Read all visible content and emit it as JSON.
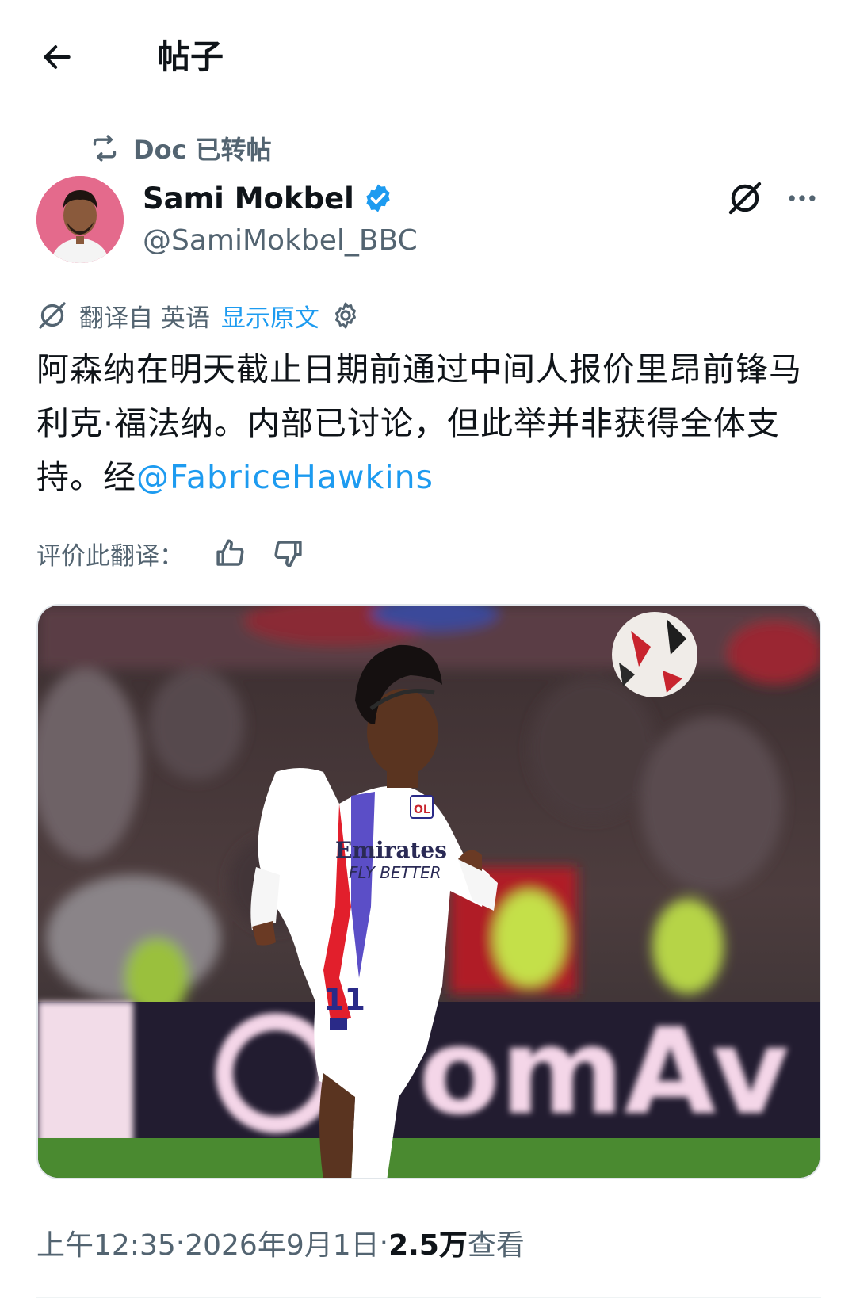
{
  "header": {
    "title": "帖子",
    "back_icon": "arrow-left-icon"
  },
  "retweet": {
    "text": "Doc 已转帖",
    "icon": "retweet-icon"
  },
  "author": {
    "name": "Sami Mokbel",
    "handle": "@SamiMokbel_BBC",
    "verified_color": "#1d9bf0",
    "avatar_bg": "#e46a8c"
  },
  "translation": {
    "label": "翻译自 英语",
    "show_original": "显示原文",
    "settings_icon": "gear-icon"
  },
  "tweet": {
    "text_main": "阿森纳在明天截止日期前通过中间人报价里昂前锋马利克·福法纳。内部已讨论，但此举并非获得全体支持。经",
    "mention": "@FabriceHawkins"
  },
  "rate": {
    "label": "评价此翻译："
  },
  "media": {
    "kit_sponsor": "Emirates",
    "kit_slogan": "FLY BETTER",
    "shirt_number": "11",
    "board_text": "omAv"
  },
  "meta": {
    "time": "上午12:35",
    "sep1": " · ",
    "date": "2026年9月1日",
    "sep2": " · ",
    "views_count": "2.5万",
    "views_label": " 查看"
  },
  "colors": {
    "accent": "#1d9bf0",
    "text_secondary": "#536471",
    "text_primary": "#0f1419"
  }
}
